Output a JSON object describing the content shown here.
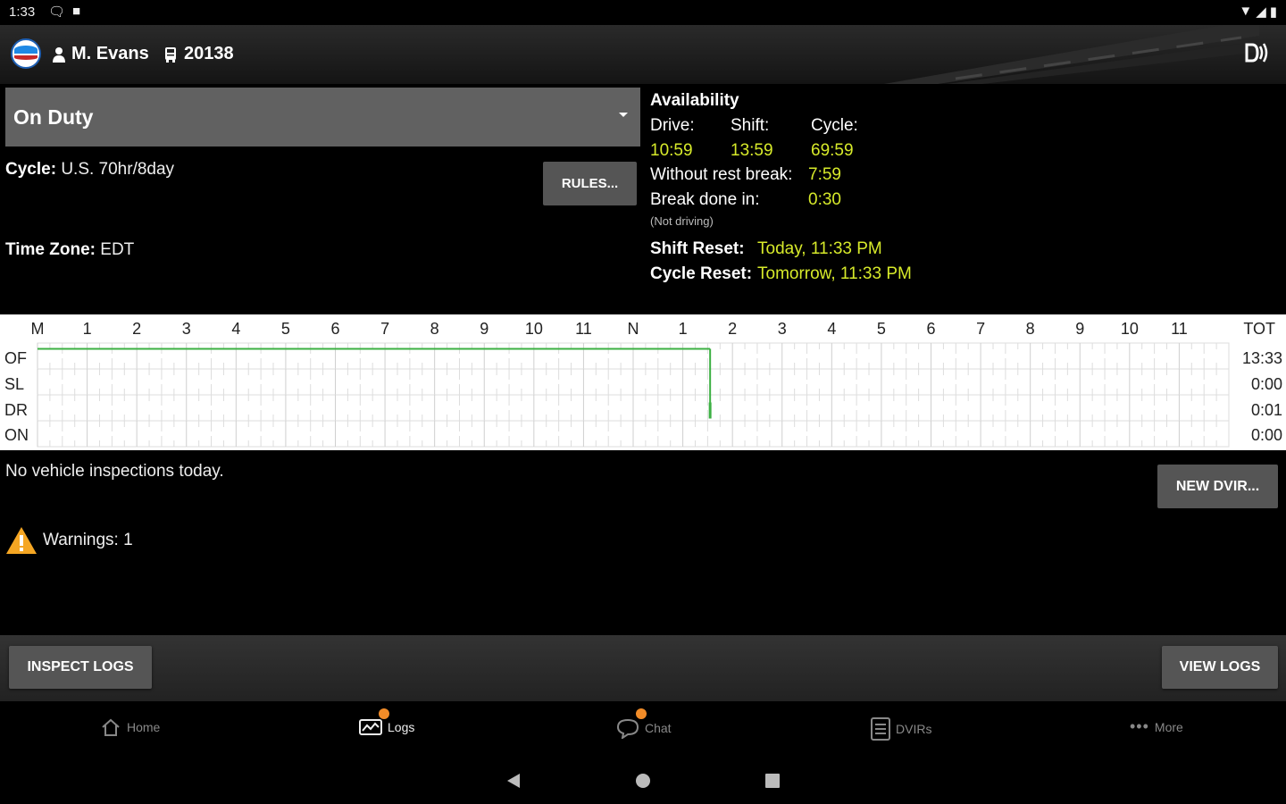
{
  "status_bar": {
    "time": "1:33",
    "left_icons": [
      "chat-notification-icon",
      "sim-icon"
    ],
    "right_icons": [
      "wifi-icon",
      "signal-icon",
      "battery-icon"
    ]
  },
  "header": {
    "driver_name": "M. Evans",
    "vehicle_number": "20138",
    "logo": "app-logo",
    "bluetooth_icon": "bluetooth-connection-icon"
  },
  "duty_status": {
    "selected": "On Duty"
  },
  "cycle": {
    "label": "Cycle:",
    "value": "U.S. 70hr/8day"
  },
  "timezone": {
    "label": "Time Zone:",
    "value": "EDT"
  },
  "rules_button": "RULES...",
  "availability": {
    "title": "Availability",
    "drive_label": "Drive:",
    "shift_label": "Shift:",
    "cycle_label": "Cycle:",
    "drive_value": "10:59",
    "shift_value": "13:59",
    "cycle_value": "69:59",
    "without_rest_label": "Without rest break:",
    "without_rest_value": "7:59",
    "break_done_label": "Break done in:",
    "break_done_value": "0:30",
    "not_driving": "(Not driving)",
    "shift_reset_label": "Shift Reset:",
    "shift_reset_value": "Today, 11:33 PM",
    "cycle_reset_label": "Cycle Reset:",
    "cycle_reset_value": "Tomorrow, 11:33 PM"
  },
  "log_graph": {
    "hour_labels": [
      "M",
      "1",
      "2",
      "3",
      "4",
      "5",
      "6",
      "7",
      "8",
      "9",
      "10",
      "11",
      "N",
      "1",
      "2",
      "3",
      "4",
      "5",
      "6",
      "7",
      "8",
      "9",
      "10",
      "11"
    ],
    "total_header": "TOT",
    "rows": [
      {
        "label": "OF",
        "total": "13:33"
      },
      {
        "label": "SL",
        "total": "0:00"
      },
      {
        "label": "DR",
        "total": "0:01"
      },
      {
        "label": "ON",
        "total": "0:00"
      }
    ],
    "status_line_color": "#3cb043"
  },
  "inspections": {
    "text": "No vehicle inspections today.",
    "new_dvir_button": "NEW DVIR..."
  },
  "warnings": {
    "text": "Warnings: 1",
    "icon_color": "#f5a623"
  },
  "actions": {
    "inspect_logs": "INSPECT LOGS",
    "view_logs": "VIEW LOGS"
  },
  "tabs": [
    {
      "label": "Home",
      "icon": "home-icon",
      "badge": false
    },
    {
      "label": "Logs",
      "icon": "logs-icon",
      "badge": true
    },
    {
      "label": "Chat",
      "icon": "chat-icon",
      "badge": true
    },
    {
      "label": "DVIRs",
      "icon": "dvir-icon",
      "badge": false
    },
    {
      "label": "More",
      "icon": "more-icon",
      "badge": false
    }
  ],
  "badge_color": "#f28c28",
  "android_nav": [
    "back-icon",
    "home-circle-icon",
    "recents-icon"
  ]
}
